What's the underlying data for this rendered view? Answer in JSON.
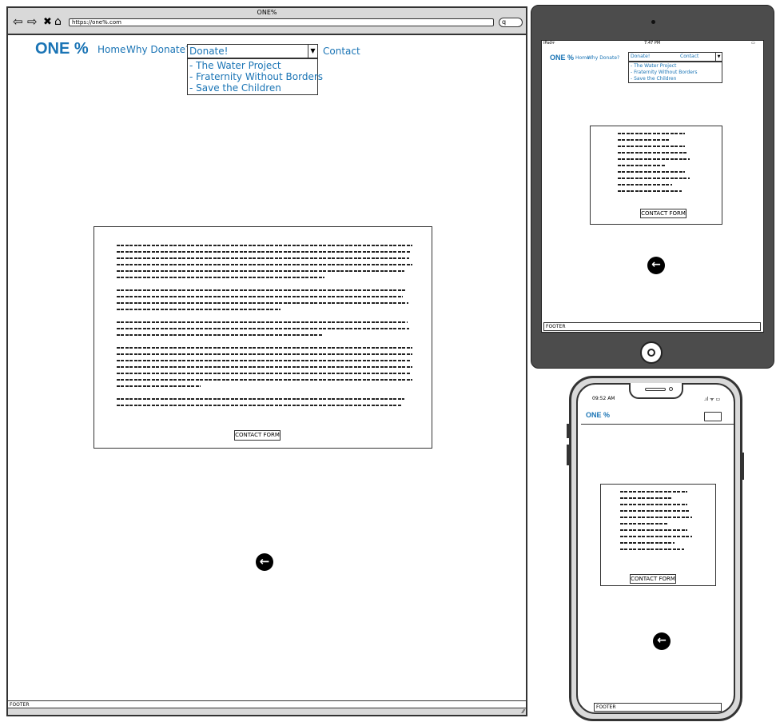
{
  "desktop": {
    "window_title": "ONE%",
    "nav_icons": [
      "back-arrow-icon",
      "forward-arrow-icon",
      "close-icon",
      "home-icon"
    ],
    "url": "https://one%.com",
    "logo": "ONE %",
    "nav": {
      "home": "Home",
      "why": "Why Donate?",
      "donate_select": "Donate!",
      "contact": "Contact"
    },
    "donate_options": [
      "- The Water Project",
      "- Fraternity Without Borders",
      "- Save the Children"
    ],
    "contact_button": "CONTACT FORM",
    "footer": "FOOTER"
  },
  "tablet": {
    "status_left": "iPad",
    "status_time": "7:47 PM",
    "logo": "ONE %",
    "nav": {
      "home": "Home",
      "why": "Why Donate?",
      "donate_select": "Donate!",
      "contact": "Contact"
    },
    "donate_options": [
      "- The Water Project",
      "- Fraternity Without Borders",
      "- Save the Children"
    ],
    "contact_button": "CONTACT FORM",
    "footer": "FOOTER"
  },
  "phone": {
    "status_time": "09:52 AM",
    "logo": "ONE %",
    "contact_button": "CONTACT FORM",
    "footer": "FOOTER"
  }
}
